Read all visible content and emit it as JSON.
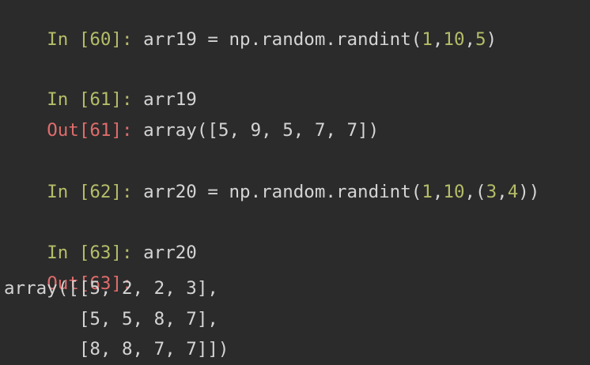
{
  "colors": {
    "background": "#2b2b2b",
    "in_prompt": "#b5bd68",
    "out_prompt": "#e06c6c",
    "code_text": "#d4d4d4"
  },
  "cells": {
    "c60": {
      "in_label": "In [60]:",
      "code_a": " arr19 = np.random.randint(",
      "lit_1": "1",
      "sep_1": ",",
      "lit_2": "10",
      "sep_2": ",",
      "lit_3": "5",
      "code_b": ")"
    },
    "c61": {
      "in_label": "In [61]:",
      "code": " arr19",
      "out_label": "Out[61]:",
      "output": " array([5, 9, 5, 7, 7])"
    },
    "c62": {
      "in_label": "In [62]:",
      "code_a": " arr20 = np.random.randint(",
      "lit_1": "1",
      "sep_1": ",",
      "lit_2": "10",
      "sep_2": ",(",
      "lit_3": "3",
      "sep_3": ",",
      "lit_4": "4",
      "code_b": "))"
    },
    "c63": {
      "in_label": "In [63]:",
      "code": " arr20",
      "out_label": "Out[63]:",
      "output_lines": [
        "array([[5, 2, 2, 3],",
        "       [5, 5, 8, 7],",
        "       [8, 8, 7, 7]])"
      ]
    }
  }
}
